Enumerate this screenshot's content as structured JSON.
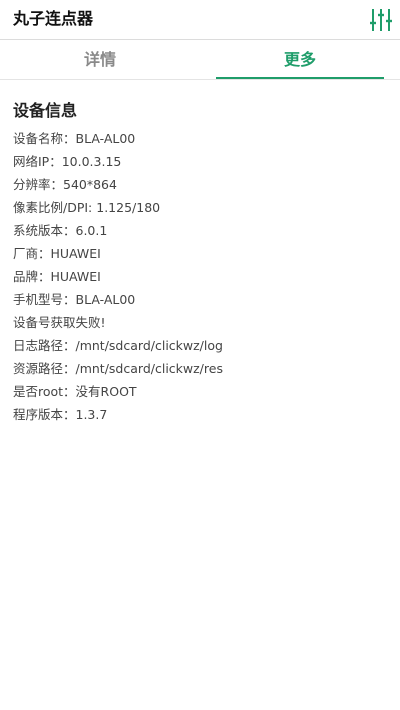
{
  "app": {
    "title": "丸子连点器",
    "settings_icon": "sliders-icon",
    "accent_color": "#1f9d6a"
  },
  "tabs": [
    {
      "label": "详情",
      "active": false
    },
    {
      "label": "更多",
      "active": true
    }
  ],
  "device_info": {
    "section_title": "设备信息",
    "rows": [
      "设备名称：BLA-AL00",
      "网络IP：10.0.3.15",
      "分辨率：540*864",
      "像素比例/DPI: 1.125/180",
      "系统版本：6.0.1",
      "厂商：HUAWEI",
      "品牌：HUAWEI",
      "手机型号：BLA-AL00",
      "设备号获取失败!",
      "日志路径：/mnt/sdcard/clickwz/log",
      "资源路径：/mnt/sdcard/clickwz/res",
      "是否root：没有ROOT",
      "程序版本：1.3.7"
    ]
  }
}
